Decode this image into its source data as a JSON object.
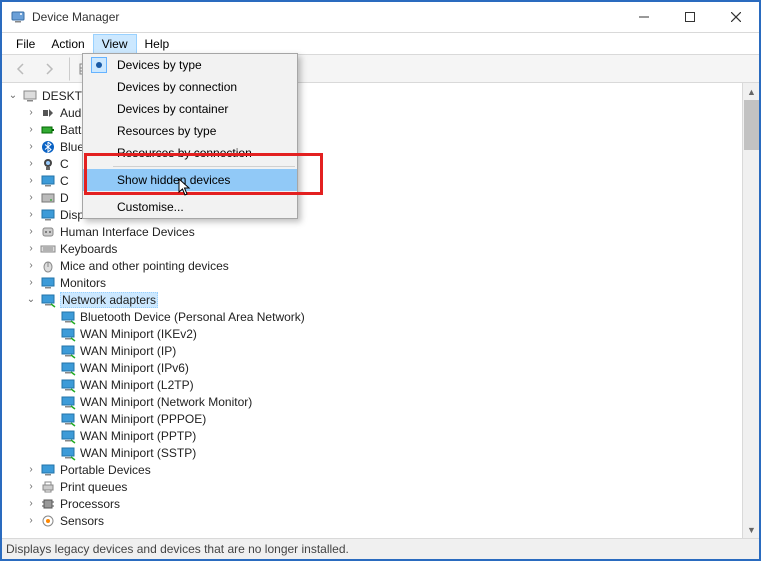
{
  "title": "Device Manager",
  "menubar": [
    "File",
    "Action",
    "View",
    "Help"
  ],
  "menubar_active_index": 2,
  "view_menu": {
    "items": [
      {
        "label": "Devices by type",
        "checked": true,
        "highlight": false
      },
      {
        "label": "Devices by connection",
        "checked": false,
        "highlight": false
      },
      {
        "label": "Devices by container",
        "checked": false,
        "highlight": false
      },
      {
        "label": "Resources by type",
        "checked": false,
        "highlight": false
      },
      {
        "label": "Resources by connection",
        "checked": false,
        "highlight": false
      }
    ],
    "items2": [
      {
        "label": "Show hidden devices",
        "checked": false,
        "highlight": true
      }
    ],
    "items3": [
      {
        "label": "Customise...",
        "checked": false,
        "highlight": false
      }
    ]
  },
  "root": "DESKTO",
  "tree": [
    {
      "label": "Aud",
      "icon": "audio",
      "exp": "›"
    },
    {
      "label": "Batt",
      "icon": "battery",
      "exp": "›"
    },
    {
      "label": "Blue",
      "icon": "bluetooth",
      "exp": "›"
    },
    {
      "label": "C",
      "icon": "camera",
      "exp": "›"
    },
    {
      "label": "C",
      "icon": "monitor",
      "exp": "›"
    },
    {
      "label": "D",
      "icon": "disk",
      "exp": "›"
    },
    {
      "label": "Disp",
      "icon": "display",
      "exp": "›"
    },
    {
      "label": "Human Interface Devices",
      "icon": "hid",
      "exp": "›"
    },
    {
      "label": "Keyboards",
      "icon": "keyboard",
      "exp": "›"
    },
    {
      "label": "Mice and other pointing devices",
      "icon": "mouse",
      "exp": "›"
    },
    {
      "label": "Monitors",
      "icon": "monitor",
      "exp": "›"
    },
    {
      "label": "Network adapters",
      "icon": "network",
      "exp": "⌄",
      "selected": true
    },
    {
      "label": "Portable Devices",
      "icon": "portable",
      "exp": "›"
    },
    {
      "label": "Print queues",
      "icon": "printer",
      "exp": "›"
    },
    {
      "label": "Processors",
      "icon": "cpu",
      "exp": "›"
    },
    {
      "label": "Sensors",
      "icon": "sensor",
      "exp": "›"
    }
  ],
  "network_children": [
    "Bluetooth Device (Personal Area Network)",
    "WAN Miniport (IKEv2)",
    "WAN Miniport (IP)",
    "WAN Miniport (IPv6)",
    "WAN Miniport (L2TP)",
    "WAN Miniport (Network Monitor)",
    "WAN Miniport (PPPOE)",
    "WAN Miniport (PPTP)",
    "WAN Miniport (SSTP)"
  ],
  "status": "Displays legacy devices and devices that are no longer installed."
}
